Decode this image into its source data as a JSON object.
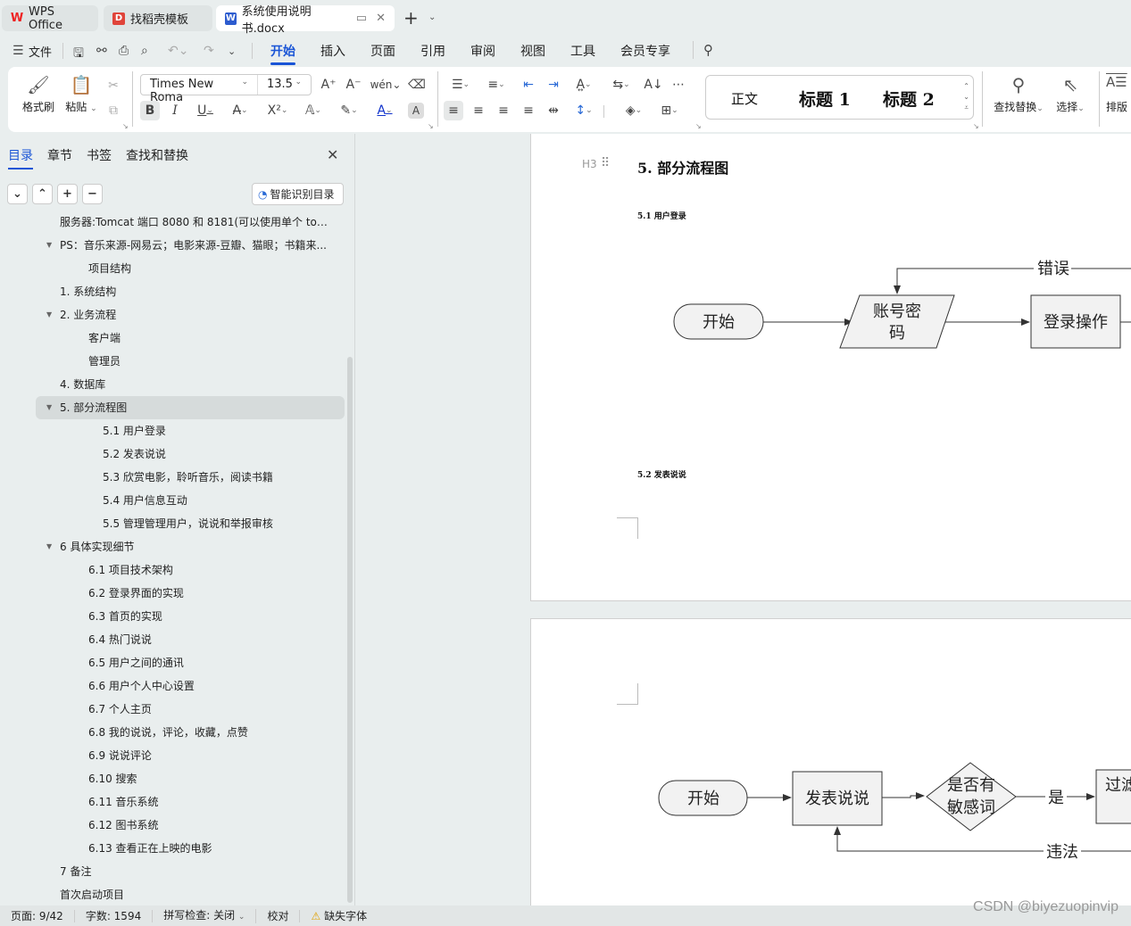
{
  "tabs": [
    {
      "label": "WPS Office",
      "icon": "wps-logo-icon"
    },
    {
      "label": "找稻壳模板",
      "icon": "docer-icon"
    },
    {
      "label": "系统使用说明书.docx",
      "icon": "word-doc-icon",
      "active": true
    }
  ],
  "menu": {
    "file": "文件",
    "items": [
      "开始",
      "插入",
      "页面",
      "引用",
      "审阅",
      "视图",
      "工具",
      "会员专享"
    ],
    "active": "开始"
  },
  "ribbon": {
    "format_painter": "格式刷",
    "paste": "粘贴",
    "font_name": "Times New Roma",
    "font_size": "13.5",
    "styles": [
      "正文",
      "标题 1",
      "标题 2"
    ],
    "find_replace": "查找替换",
    "select": "选择",
    "layout": "排版"
  },
  "panel": {
    "tabs": [
      "目录",
      "章节",
      "书签",
      "查找和替换"
    ],
    "active_tab": "目录",
    "smart_toc": "智能识别目录",
    "toc": [
      {
        "text": "服务器:Tomcat 端口 8080 和 8181(可以使用单个 tomc...",
        "level": 1,
        "arrow": false
      },
      {
        "text": "PS：音乐来源-网易云；电影来源-豆瓣、猫眼；书籍来...",
        "level": 1,
        "arrow": true
      },
      {
        "text": "项目结构",
        "level": 2,
        "arrow": false
      },
      {
        "text": "1. 系统结构",
        "level": 1,
        "arrow": false
      },
      {
        "text": "2. 业务流程",
        "level": 1,
        "arrow": true
      },
      {
        "text": "客户端",
        "level": 2,
        "arrow": false
      },
      {
        "text": "管理员",
        "level": 2,
        "arrow": false
      },
      {
        "text": "4. 数据库",
        "level": 1,
        "arrow": false
      },
      {
        "text": "5. 部分流程图",
        "level": 1,
        "arrow": true,
        "selected": true
      },
      {
        "text": "5.1  用户登录",
        "level": 3,
        "arrow": false
      },
      {
        "text": "5.2  发表说说",
        "level": 3,
        "arrow": false
      },
      {
        "text": "5.3  欣赏电影，聆听音乐，阅读书籍",
        "level": 3,
        "arrow": false
      },
      {
        "text": "5.4  用户信息互动",
        "level": 3,
        "arrow": false
      },
      {
        "text": "5.5  管理管理用户，说说和举报审核",
        "level": 3,
        "arrow": false
      },
      {
        "text": "6  具体实现细节",
        "level": 1,
        "arrow": true
      },
      {
        "text": "6.1  项目技术架构",
        "level": 2,
        "arrow": false
      },
      {
        "text": "6.2  登录界面的实现",
        "level": 2,
        "arrow": false
      },
      {
        "text": "6.3  首页的实现",
        "level": 2,
        "arrow": false
      },
      {
        "text": "6.4  热门说说",
        "level": 2,
        "arrow": false
      },
      {
        "text": "6.5  用户之间的通讯",
        "level": 2,
        "arrow": false
      },
      {
        "text": "6.6  用户个人中心设置",
        "level": 2,
        "arrow": false
      },
      {
        "text": "6.7  个人主页",
        "level": 2,
        "arrow": false
      },
      {
        "text": "6.8  我的说说，评论，收藏，点赞",
        "level": 2,
        "arrow": false
      },
      {
        "text": "6.9  说说评论",
        "level": 2,
        "arrow": false
      },
      {
        "text": "6.10  搜索",
        "level": 2,
        "arrow": false
      },
      {
        "text": "6.11  音乐系统",
        "level": 2,
        "arrow": false
      },
      {
        "text": "6.12  图书系统",
        "level": 2,
        "arrow": false
      },
      {
        "text": "6.13  查看正在上映的电影",
        "level": 2,
        "arrow": false
      },
      {
        "text": "7  备注",
        "level": 1,
        "arrow": false
      },
      {
        "text": "首次启动项目",
        "level": 1,
        "arrow": false
      }
    ]
  },
  "document": {
    "heading_marker": "H3",
    "heading": "5.  部分流程图",
    "sub1": "5.1  用户登录",
    "sub2": "5.2  发表说说",
    "flow1": {
      "start": "开始",
      "input_line1": "账号密",
      "input_line2": "码",
      "process": "登录操作",
      "error_label": "错误"
    },
    "flow2": {
      "start": "开始",
      "process": "发表说说",
      "decision_line1": "是否有",
      "decision_line2": "敏感词",
      "yes_label": "是",
      "next": "过滤",
      "illegal_label": "违法"
    }
  },
  "status": {
    "page": "页面: 9/42",
    "words": "字数: 1594",
    "spell": "拼写检查: 关闭",
    "proofread": "校对",
    "missing_font": "缺失字体"
  },
  "watermark": "CSDN @biyezuopinvip"
}
